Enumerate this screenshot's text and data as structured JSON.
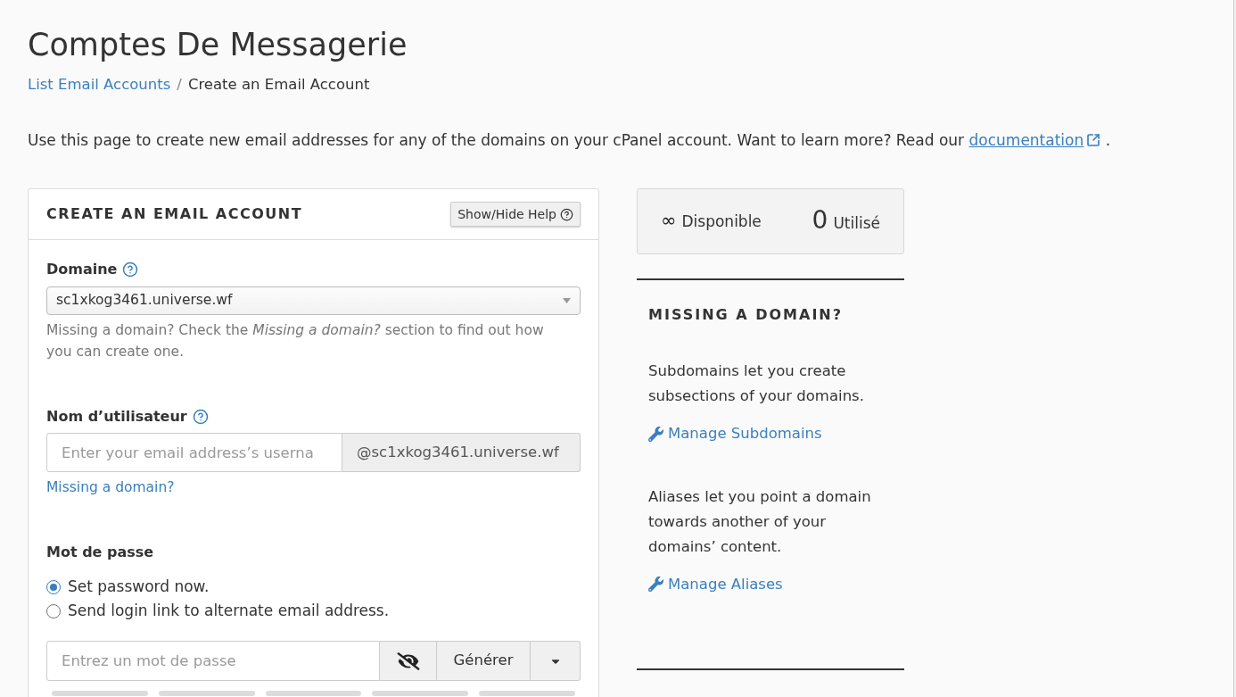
{
  "page": {
    "title": "Comptes De Messagerie"
  },
  "breadcrumb": {
    "separator": "/",
    "items": [
      {
        "label": "List Email Accounts",
        "kind": "link"
      },
      {
        "label": "Create an Email Account",
        "kind": "current"
      }
    ]
  },
  "intro": {
    "text": "Use this page to create new email addresses for any of the domains on your cPanel account. Want to learn more? Read our",
    "link": "documentation",
    "end": "."
  },
  "create_panel": {
    "title": "CREATE AN EMAIL ACCOUNT",
    "help_button": "Show/Hide Help",
    "domain": {
      "label": "Domaine",
      "value": "sc1xkog3461.universe.wf",
      "help": "Missing a domain? Check the *Missing a domain?* section to find out how you can create one."
    },
    "username": {
      "label": "Nom d’utilisateur",
      "placeholder": "Enter your email address’s userna",
      "suffix": "@sc1xkog3461.universe.wf",
      "link": "Missing a domain?"
    },
    "password": {
      "label": "Mot de passe",
      "options": [
        {
          "label": "Set password now.",
          "selected": true
        },
        {
          "label": "Send login link to alternate email address.",
          "selected": false
        }
      ],
      "placeholder": "Entrez un mot de passe",
      "generate_button": "Générer"
    }
  },
  "stats": [
    {
      "value": "∞",
      "label": "Disponible",
      "kind": "available"
    },
    {
      "value": "0",
      "label": "Utilisé",
      "kind": "used"
    }
  ],
  "missing_domain": {
    "title": "MISSING A DOMAIN?",
    "sections": [
      {
        "text": "Subdomains let you create subsections of your domains.",
        "link": "Manage Subdomains"
      },
      {
        "text": "Aliases let you point a domain towards another of your domains’ content.",
        "link": "Manage Aliases"
      }
    ]
  }
}
